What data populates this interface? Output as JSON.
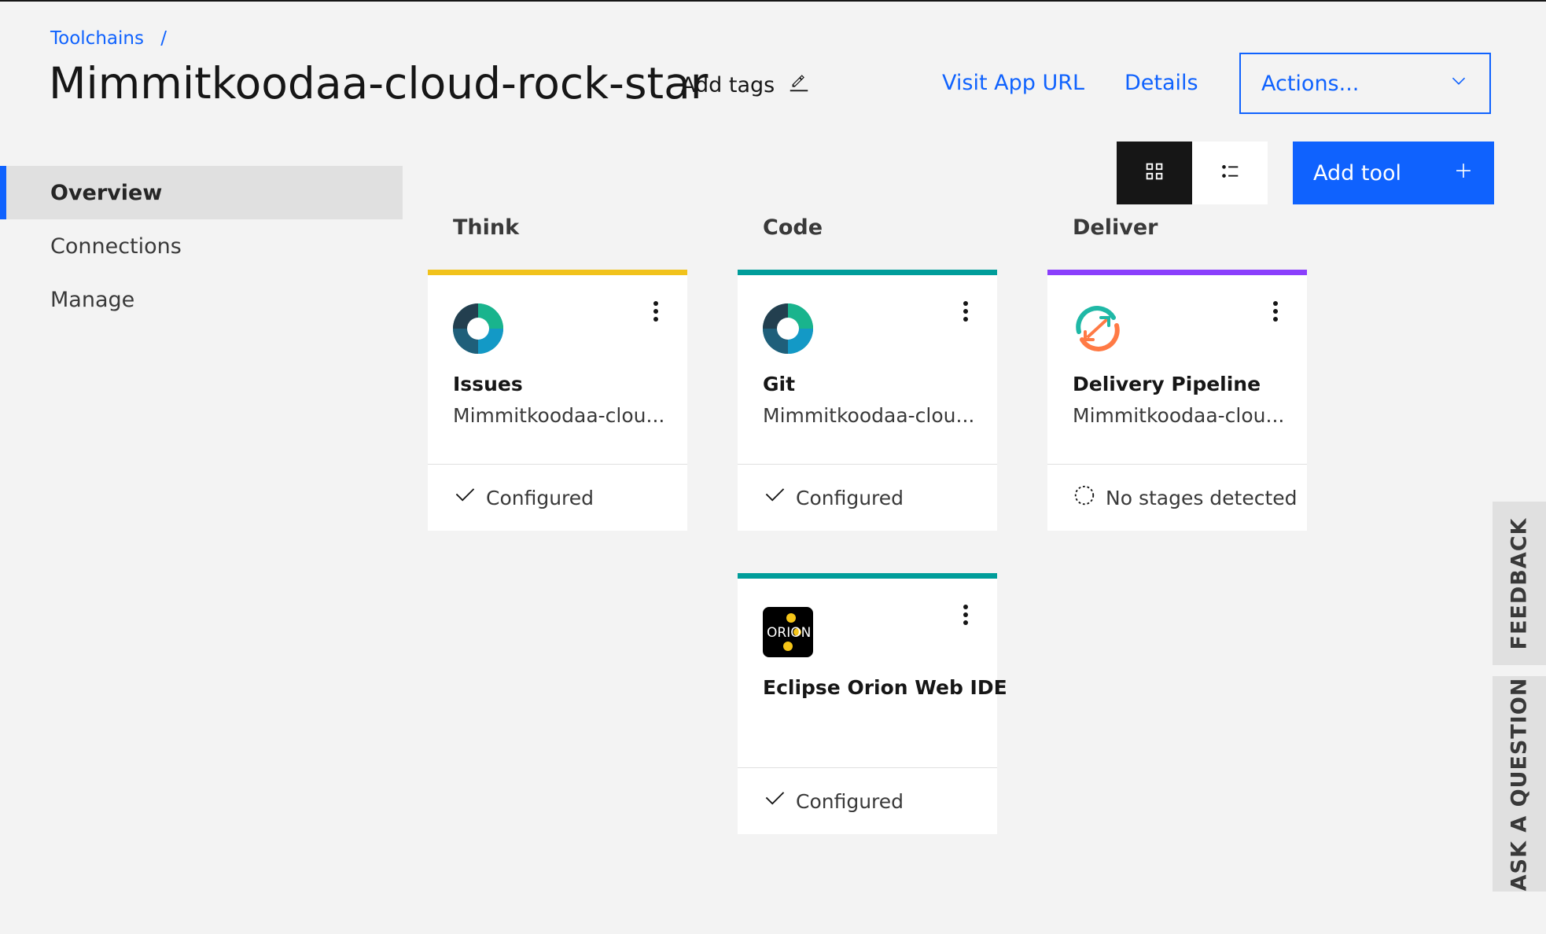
{
  "breadcrumb": {
    "link": "Toolchains",
    "separator": "/"
  },
  "header": {
    "title": "Mimmitkoodaa-cloud-rock-star",
    "add_tags": "Add tags",
    "visit_app_url": "Visit App URL",
    "details": "Details",
    "actions": "Actions..."
  },
  "sidebar": {
    "items": [
      {
        "label": "Overview",
        "active": true
      },
      {
        "label": "Connections",
        "active": false
      },
      {
        "label": "Manage",
        "active": false
      }
    ]
  },
  "toolbar": {
    "grid_view_icon": "grid-icon",
    "list_view_icon": "list-icon",
    "add_tool": "Add tool"
  },
  "columns": {
    "think": "Think",
    "code": "Code",
    "deliver": "Deliver"
  },
  "cards": {
    "issues": {
      "name": "Issues",
      "sub": "Mimmitkoodaa-clou...",
      "status": "Configured",
      "stripe": "#f1c21b"
    },
    "git": {
      "name": "Git",
      "sub": "Mimmitkoodaa-clou...",
      "status": "Configured",
      "stripe": "#009d9a"
    },
    "pipeline": {
      "name": "Delivery Pipeline",
      "sub": "Mimmitkoodaa-clou...",
      "status": "No stages detected",
      "stripe": "#8a3ffc"
    },
    "orion": {
      "name": "Eclipse Orion Web IDE",
      "status": "Configured",
      "stripe": "#009d9a",
      "logo_text": "ORION"
    }
  },
  "side_tabs": {
    "feedback": "FEEDBACK",
    "ask": "ASK A QUESTION"
  },
  "colors": {
    "primary": "#0f62fe",
    "think": "#f1c21b",
    "code": "#009d9a",
    "deliver": "#8a3ffc"
  }
}
